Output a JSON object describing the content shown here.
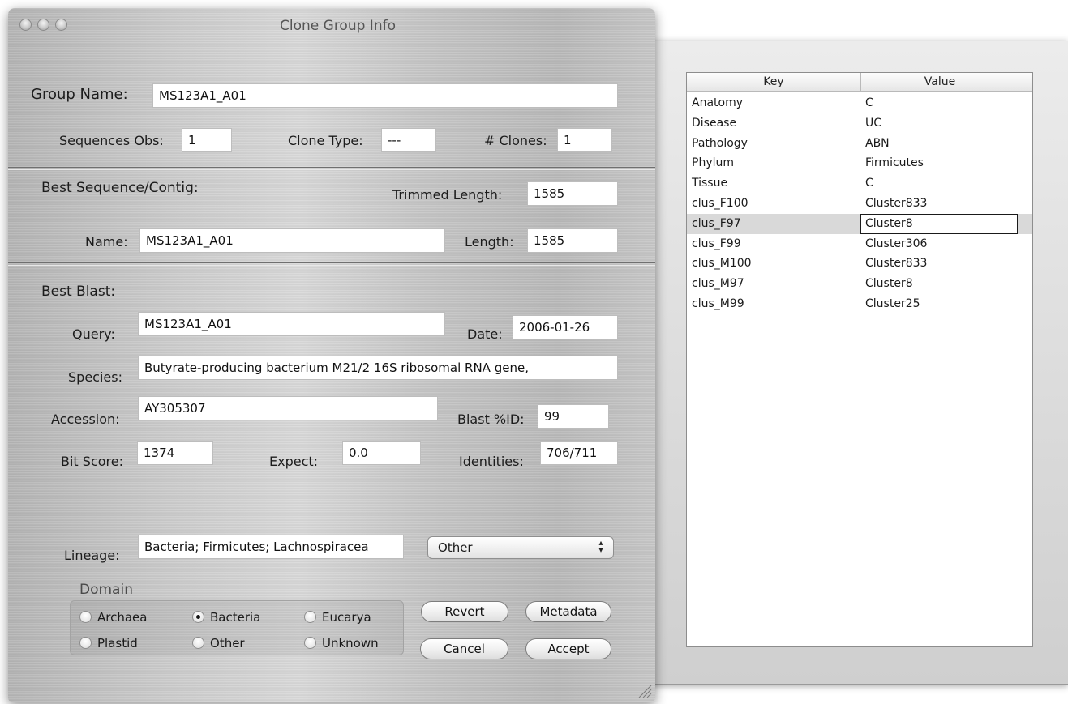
{
  "window": {
    "title": "Clone Group Info"
  },
  "group": {
    "name_label": "Group Name:",
    "name_value": "MS123A1_A01",
    "seq_obs_label": "Sequences Obs:",
    "seq_obs_value": "1",
    "clone_type_label": "Clone Type:",
    "clone_type_value": "---",
    "clones_label": "# Clones:",
    "clones_value": "1"
  },
  "best_sequence": {
    "section_title": "Best Sequence/Contig:",
    "trimmed_length_label": "Trimmed Length:",
    "trimmed_length_value": "1585",
    "name_label": "Name:",
    "name_value": "MS123A1_A01",
    "length_label": "Length:",
    "length_value": "1585"
  },
  "best_blast": {
    "section_title": "Best Blast:",
    "query_label": "Query:",
    "query_value": "MS123A1_A01",
    "date_label": "Date:",
    "date_value": "2006-01-26",
    "species_label": "Species:",
    "species_value": "Butyrate-producing bacterium M21/2 16S ribosomal RNA gene,",
    "accession_label": "Accession:",
    "accession_value": "AY305307",
    "blast_id_label": "Blast %ID:",
    "blast_id_value": "99",
    "bit_score_label": "Bit Score:",
    "bit_score_value": "1374",
    "expect_label": "Expect:",
    "expect_value": "0.0",
    "identities_label": "Identities:",
    "identities_value": "706/711"
  },
  "lineage": {
    "label": "Lineage:",
    "value": "Bacteria; Firmicutes; Lachnospiracea",
    "popup_selected": "Other"
  },
  "domain": {
    "title": "Domain",
    "options": {
      "archaea": "Archaea",
      "bacteria": "Bacteria",
      "eucarya": "Eucarya",
      "plastid": "Plastid",
      "other": "Other",
      "unknown": "Unknown"
    },
    "selected": "Bacteria"
  },
  "buttons": {
    "revert": "Revert",
    "metadata": "Metadata",
    "cancel": "Cancel",
    "accept": "Accept"
  },
  "metadata_table": {
    "columns": [
      "Key",
      "Value"
    ],
    "rows": [
      {
        "key": "Anatomy",
        "value": "C"
      },
      {
        "key": "Disease",
        "value": "UC"
      },
      {
        "key": "Pathology",
        "value": "ABN"
      },
      {
        "key": "Phylum",
        "value": "Firmicutes"
      },
      {
        "key": "Tissue",
        "value": "C"
      },
      {
        "key": "clus_F100",
        "value": "Cluster833"
      },
      {
        "key": "clus_F97",
        "value": "Cluster8"
      },
      {
        "key": "clus_F99",
        "value": "Cluster306"
      },
      {
        "key": "clus_M100",
        "value": "Cluster833"
      },
      {
        "key": "clus_M97",
        "value": "Cluster8"
      },
      {
        "key": "clus_M99",
        "value": "Cluster25"
      }
    ],
    "selected_row": "clus_F97"
  }
}
